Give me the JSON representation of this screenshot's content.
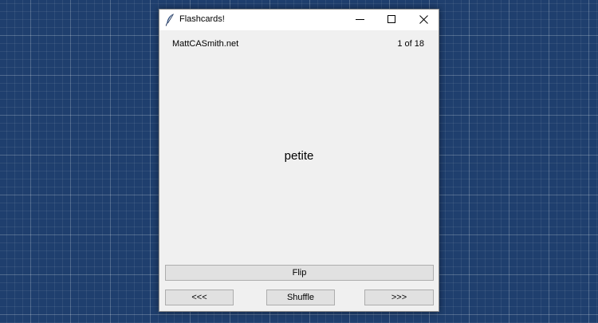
{
  "window": {
    "title": "Flashcards!",
    "icons": {
      "app": "feather-icon",
      "minimize": "minimize-icon",
      "maximize": "maximize-icon",
      "close": "close-icon"
    }
  },
  "header": {
    "site": "MattCASmith.net",
    "counter": "1 of 18"
  },
  "card": {
    "word": "petite"
  },
  "buttons": {
    "flip": "Flip",
    "prev": "<<<",
    "shuffle": "Shuffle",
    "next": ">>>"
  },
  "colors": {
    "desktop": "#1f3f6e",
    "window_bg": "#f0f0f0",
    "button_bg": "#e1e1e1"
  }
}
